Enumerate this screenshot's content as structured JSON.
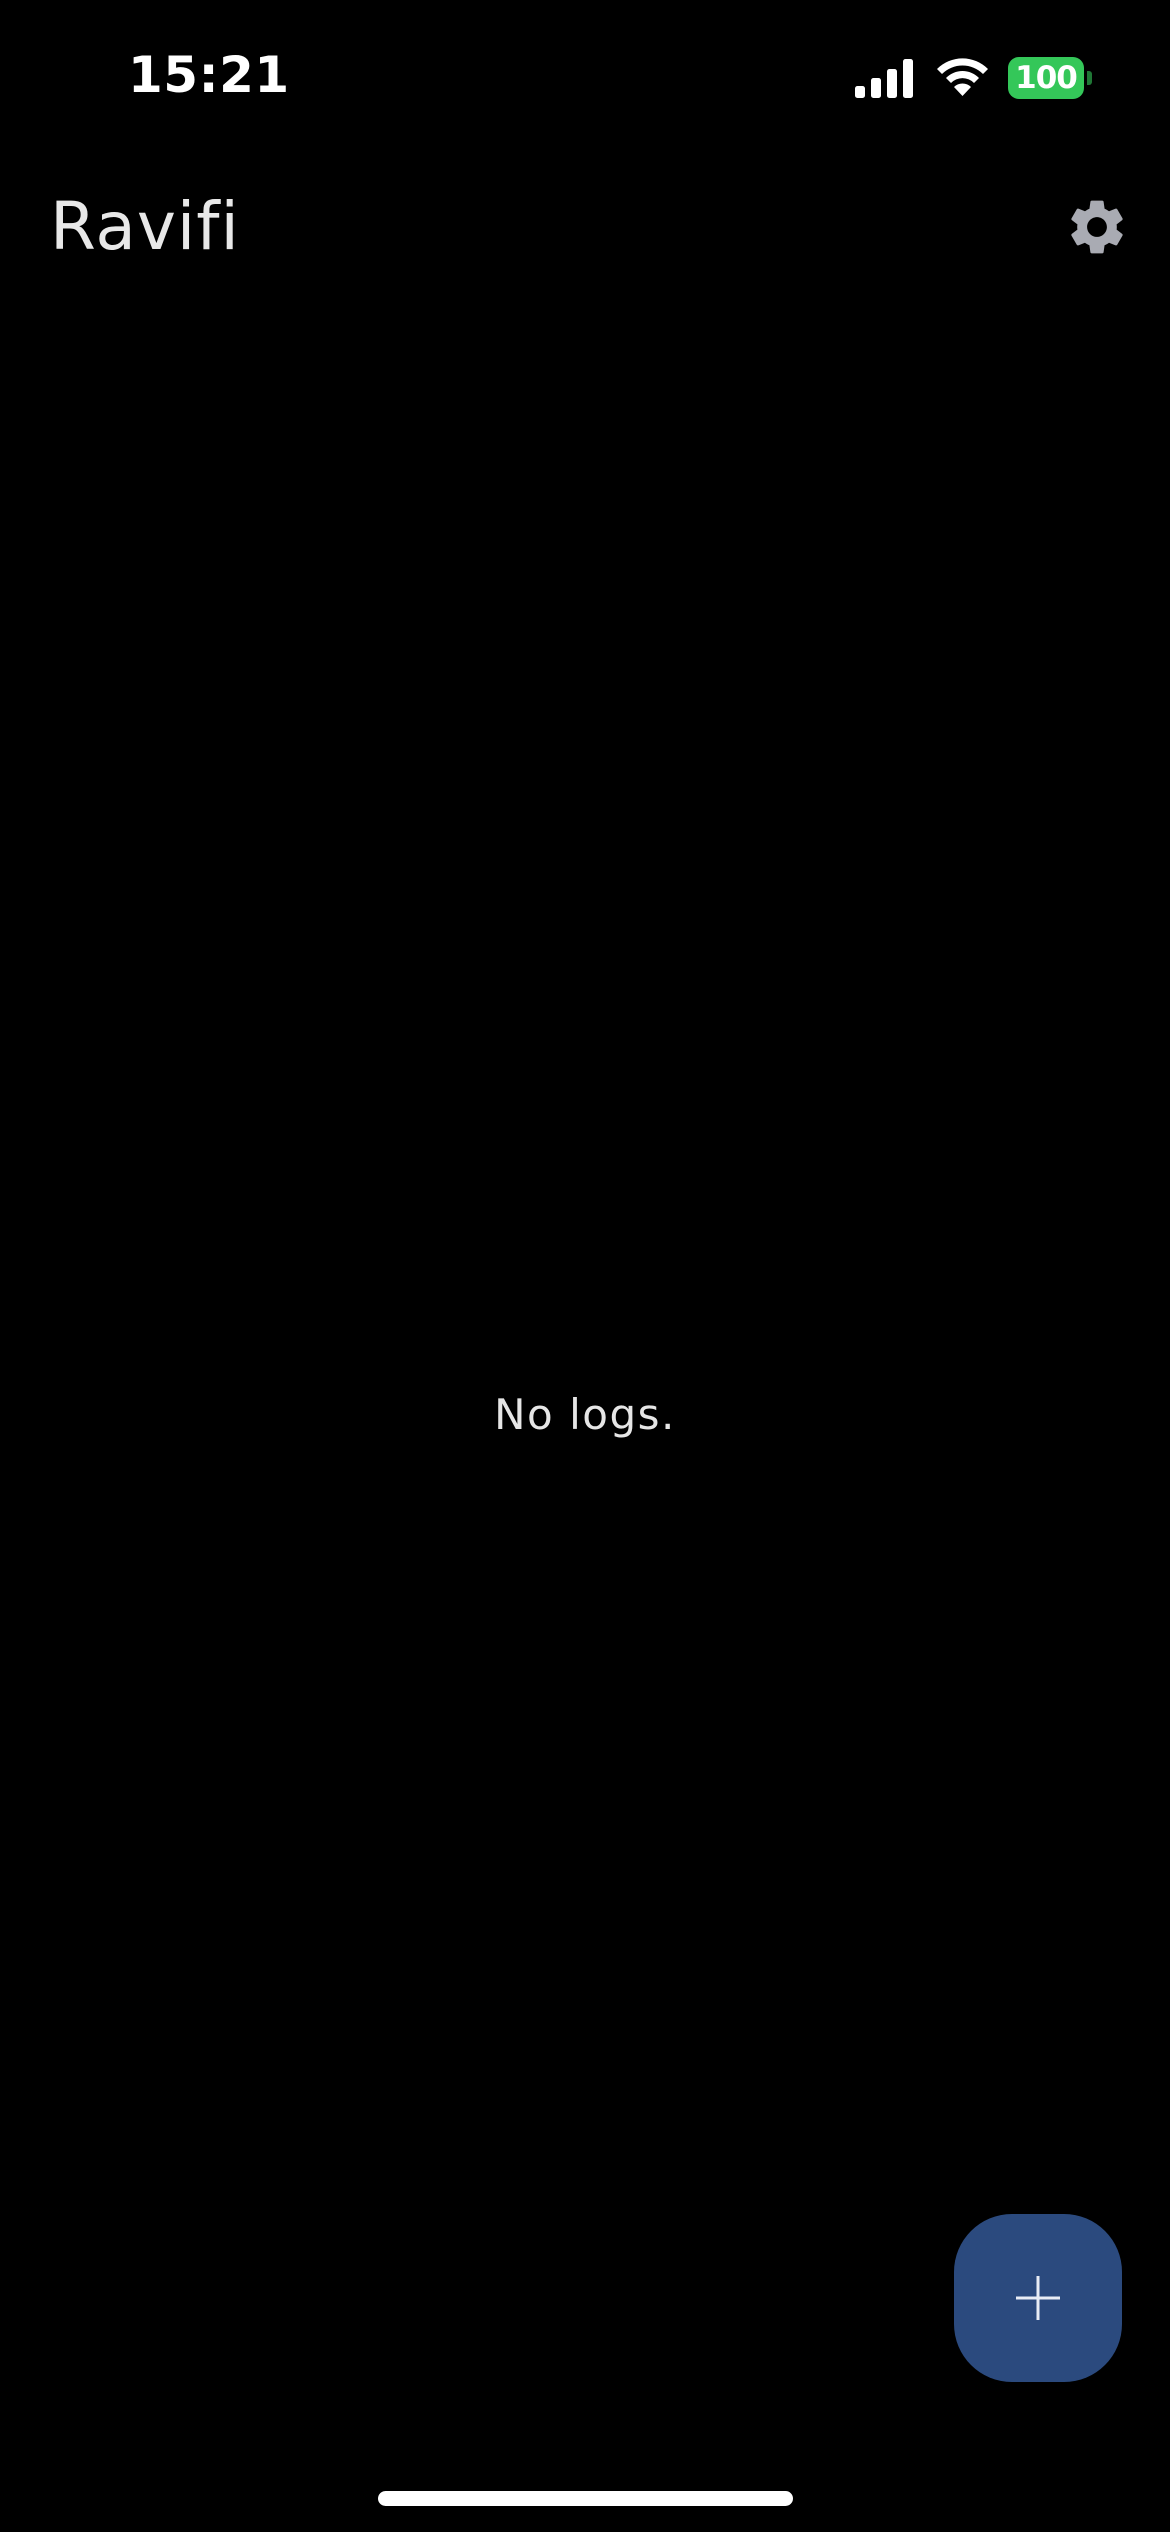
{
  "status_bar": {
    "time": "15:21",
    "battery_level": "100",
    "icons": [
      "signal-icon",
      "wifi-icon",
      "battery-icon"
    ],
    "battery_color": "#34c759"
  },
  "header": {
    "title": "Ravifi",
    "settings_icon": "gear-icon"
  },
  "main": {
    "empty_message": "No logs."
  },
  "fab": {
    "icon": "plus-icon",
    "color": "#2b4a7e"
  },
  "colors": {
    "background": "#000000",
    "text": "#e6e6e6",
    "icon_gray": "#a9abb3"
  }
}
